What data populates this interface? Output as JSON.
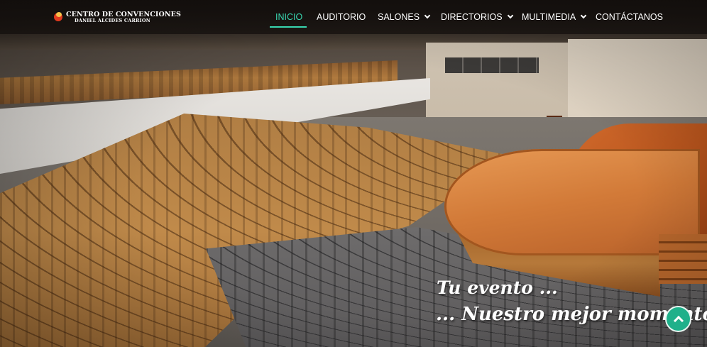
{
  "brand": {
    "line1": "CENTRO DE CONVENCIONES",
    "line2": "DANIEL ALCIDES CARRION",
    "logo_icon": "brand-logo-icon"
  },
  "nav": {
    "items": [
      {
        "label": "INICIO",
        "active": true,
        "has_dropdown": false
      },
      {
        "label": "AUDITORIO",
        "active": false,
        "has_dropdown": false
      },
      {
        "label": "SALONES",
        "active": false,
        "has_dropdown": true
      },
      {
        "label": "DIRECTORIOS",
        "active": false,
        "has_dropdown": true
      },
      {
        "label": "MULTIMEDIA",
        "active": false,
        "has_dropdown": true
      },
      {
        "label": "CONTÁCTANOS",
        "active": false,
        "has_dropdown": false
      }
    ],
    "active_color": "#39d6b0"
  },
  "hero": {
    "image_icon": "auditorium-photo",
    "tagline_line1": "Tu evento ...",
    "tagline_line2": "... Nuestro mejor momento"
  },
  "back_to_top": {
    "icon": "chevron-up-icon",
    "color": "#1fb08a"
  }
}
